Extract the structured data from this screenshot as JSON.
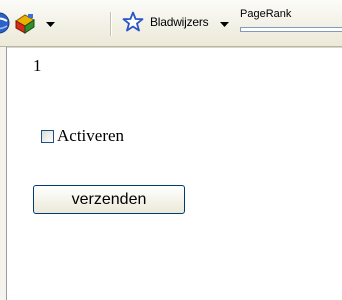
{
  "toolbar": {
    "icons": [
      "globe-icon",
      "extension-icon",
      "star-icon"
    ],
    "bookmarks_label": "Bladwijzers",
    "pagerank_label": "PageRank",
    "pagerank_value": 0
  },
  "form": {
    "number": "1",
    "checkbox_label": "Activeren",
    "checkbox_checked": false,
    "submit_label": "verzenden"
  },
  "colors": {
    "star_blue": "#2a55c8",
    "button_border": "#003c74",
    "checkbox_border": "#1c5180"
  }
}
